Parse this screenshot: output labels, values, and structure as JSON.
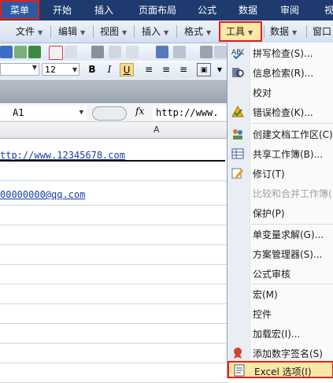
{
  "top_tabs": [
    "菜单",
    "开始",
    "插入",
    "页面布局",
    "公式",
    "数据",
    "审阅",
    "视"
  ],
  "menubar": {
    "items": [
      "文件",
      "编辑",
      "视图",
      "插入",
      "格式",
      "工具",
      "数据",
      "窗口"
    ]
  },
  "toolbar": {
    "font_size": "12",
    "bold": "B",
    "italic": "I",
    "underline": "U"
  },
  "formula_bar": {
    "name_box": "A1",
    "fx_label": "fx",
    "content": "http://www."
  },
  "sheet": {
    "column_header": "A",
    "cells": [
      "ttp://www.12345678.com",
      "00000000@qq.com"
    ]
  },
  "tools_menu": {
    "items": [
      {
        "label": "拼写检查(S)...",
        "enabled": true,
        "icon": "spellcheck-icon"
      },
      {
        "label": "信息检索(R)...",
        "enabled": true,
        "icon": "research-icon"
      },
      {
        "label": "校对",
        "enabled": true,
        "icon": ""
      },
      {
        "label": "错误检查(K)...",
        "enabled": true,
        "icon": "error-check-icon"
      },
      {
        "label": "创建文档工作区(C)",
        "enabled": true,
        "icon": "workspace-icon"
      },
      {
        "label": "共享工作簿(B)...",
        "enabled": true,
        "icon": "share-workbook-icon"
      },
      {
        "label": "修订(T)",
        "enabled": true,
        "icon": "track-changes-icon"
      },
      {
        "label": "比较和合并工作簿(",
        "enabled": false,
        "icon": ""
      },
      {
        "label": "保护(P)",
        "enabled": true,
        "icon": ""
      },
      {
        "label": "单变量求解(G)...",
        "enabled": true,
        "icon": ""
      },
      {
        "label": "方案管理器(S)...",
        "enabled": true,
        "icon": ""
      },
      {
        "label": "公式审核",
        "enabled": true,
        "icon": ""
      },
      {
        "label": "宏(M)",
        "enabled": true,
        "icon": ""
      },
      {
        "label": "控件",
        "enabled": true,
        "icon": ""
      },
      {
        "label": "加载宏(I)...",
        "enabled": true,
        "icon": ""
      },
      {
        "label": "添加数字签名(S)",
        "enabled": true,
        "icon": "signature-icon"
      },
      {
        "label": "Excel 选项(I)",
        "enabled": true,
        "icon": "options-icon"
      }
    ]
  }
}
